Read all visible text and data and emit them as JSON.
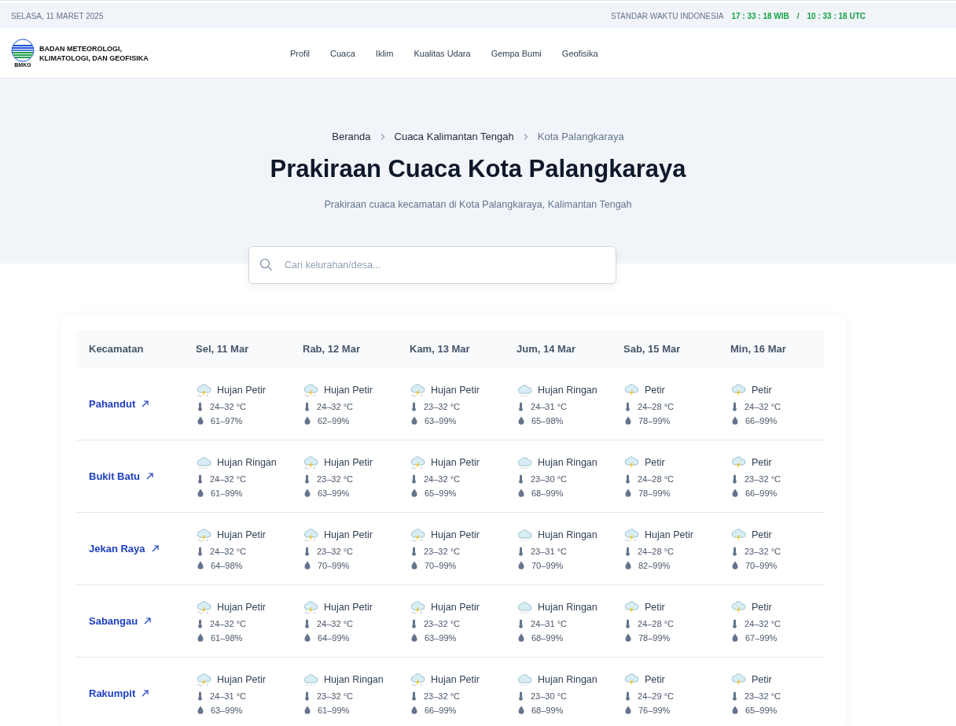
{
  "top_bar": {
    "date": "SELASA, 11 MARET 2025",
    "time_label": "STANDAR WAKTU INDONESIA",
    "local_time": "17 : 33 : 18 WIB",
    "separator": "/",
    "utc_time": "10 : 33 : 18 UTC"
  },
  "header": {
    "logo_text": "BMKG",
    "org_name_line1": "BADAN METEOROLOGI,",
    "org_name_line2": "KLIMATOLOGI, DAN GEOFISIKA",
    "nav": [
      {
        "label": "Profil"
      },
      {
        "label": "Cuaca"
      },
      {
        "label": "Iklim"
      },
      {
        "label": "Kualitas Udara"
      },
      {
        "label": "Gempa Bumi"
      },
      {
        "label": "Geofisika"
      }
    ]
  },
  "breadcrumb": [
    {
      "label": "Beranda",
      "current": false
    },
    {
      "label": "Cuaca Kalimantan Tengah",
      "current": false
    },
    {
      "label": "Kota Palangkaraya",
      "current": true
    }
  ],
  "title": "Prakiraan Cuaca Kota Palangkaraya",
  "subtitle": "Prakiraan cuaca kecamatan di Kota Palangkaraya, Kalimantan Tengah",
  "search": {
    "placeholder": "Cari kelurahan/desa..."
  },
  "table": {
    "columns": [
      "Kecamatan",
      "Sel, 11 Mar",
      "Rab, 12 Mar",
      "Kam, 13 Mar",
      "Jum, 14 Mar",
      "Sab, 15 Mar",
      "Min, 16 Mar"
    ],
    "rows": [
      {
        "name": "Pahandut",
        "days": [
          {
            "kind": "hujan-petir",
            "weather": "Hujan Petir",
            "temp": "24–32 °C",
            "humidity": "61–97%"
          },
          {
            "kind": "hujan-petir",
            "weather": "Hujan Petir",
            "temp": "24–32 °C",
            "humidity": "62–99%"
          },
          {
            "kind": "hujan-petir",
            "weather": "Hujan Petir",
            "temp": "23–32 °C",
            "humidity": "63–99%"
          },
          {
            "kind": "hujan-ringan",
            "weather": "Hujan Ringan",
            "temp": "24–31 °C",
            "humidity": "65–98%"
          },
          {
            "kind": "petir",
            "weather": "Petir",
            "temp": "24–28 °C",
            "humidity": "78–99%"
          },
          {
            "kind": "petir",
            "weather": "Petir",
            "temp": "24–32 °C",
            "humidity": "66–99%"
          }
        ]
      },
      {
        "name": "Bukit Batu",
        "days": [
          {
            "kind": "hujan-ringan",
            "weather": "Hujan Ringan",
            "temp": "24–32 °C",
            "humidity": "61–99%"
          },
          {
            "kind": "hujan-petir",
            "weather": "Hujan Petir",
            "temp": "23–32 °C",
            "humidity": "63–99%"
          },
          {
            "kind": "hujan-petir",
            "weather": "Hujan Petir",
            "temp": "24–32 °C",
            "humidity": "65–99%"
          },
          {
            "kind": "hujan-ringan",
            "weather": "Hujan Ringan",
            "temp": "23–30 °C",
            "humidity": "68–99%"
          },
          {
            "kind": "petir",
            "weather": "Petir",
            "temp": "24–28 °C",
            "humidity": "78–99%"
          },
          {
            "kind": "petir",
            "weather": "Petir",
            "temp": "23–32 °C",
            "humidity": "66–99%"
          }
        ]
      },
      {
        "name": "Jekan Raya",
        "days": [
          {
            "kind": "hujan-petir",
            "weather": "Hujan Petir",
            "temp": "24–32 °C",
            "humidity": "64–98%"
          },
          {
            "kind": "hujan-petir",
            "weather": "Hujan Petir",
            "temp": "23–32 °C",
            "humidity": "70–99%"
          },
          {
            "kind": "hujan-petir",
            "weather": "Hujan Petir",
            "temp": "23–32 °C",
            "humidity": "70–99%"
          },
          {
            "kind": "hujan-ringan",
            "weather": "Hujan Ringan",
            "temp": "23–31 °C",
            "humidity": "70–99%"
          },
          {
            "kind": "hujan-petir",
            "weather": "Hujan Petir",
            "temp": "24–28 °C",
            "humidity": "82–99%"
          },
          {
            "kind": "petir",
            "weather": "Petir",
            "temp": "23–32 °C",
            "humidity": "70–99%"
          }
        ]
      },
      {
        "name": "Sabangau",
        "days": [
          {
            "kind": "hujan-petir",
            "weather": "Hujan Petir",
            "temp": "24–32 °C",
            "humidity": "61–98%"
          },
          {
            "kind": "hujan-petir",
            "weather": "Hujan Petir",
            "temp": "24–32 °C",
            "humidity": "64–99%"
          },
          {
            "kind": "hujan-petir",
            "weather": "Hujan Petir",
            "temp": "23–32 °C",
            "humidity": "63–99%"
          },
          {
            "kind": "hujan-ringan",
            "weather": "Hujan Ringan",
            "temp": "24–31 °C",
            "humidity": "68–99%"
          },
          {
            "kind": "petir",
            "weather": "Petir",
            "temp": "24–28 °C",
            "humidity": "78–99%"
          },
          {
            "kind": "petir",
            "weather": "Petir",
            "temp": "24–32 °C",
            "humidity": "67–99%"
          }
        ]
      },
      {
        "name": "Rakumpit",
        "days": [
          {
            "kind": "hujan-petir",
            "weather": "Hujan Petir",
            "temp": "24–31 °C",
            "humidity": "63–99%"
          },
          {
            "kind": "hujan-ringan",
            "weather": "Hujan Ringan",
            "temp": "23–32 °C",
            "humidity": "61–99%"
          },
          {
            "kind": "hujan-petir",
            "weather": "Hujan Petir",
            "temp": "23–32 °C",
            "humidity": "66–99%"
          },
          {
            "kind": "hujan-ringan",
            "weather": "Hujan Ringan",
            "temp": "23–30 °C",
            "humidity": "68–99%"
          },
          {
            "kind": "petir",
            "weather": "Petir",
            "temp": "24–29 °C",
            "humidity": "76–99%"
          },
          {
            "kind": "petir",
            "weather": "Petir",
            "temp": "23–32 °C",
            "humidity": "65–99%"
          }
        ]
      }
    ]
  }
}
